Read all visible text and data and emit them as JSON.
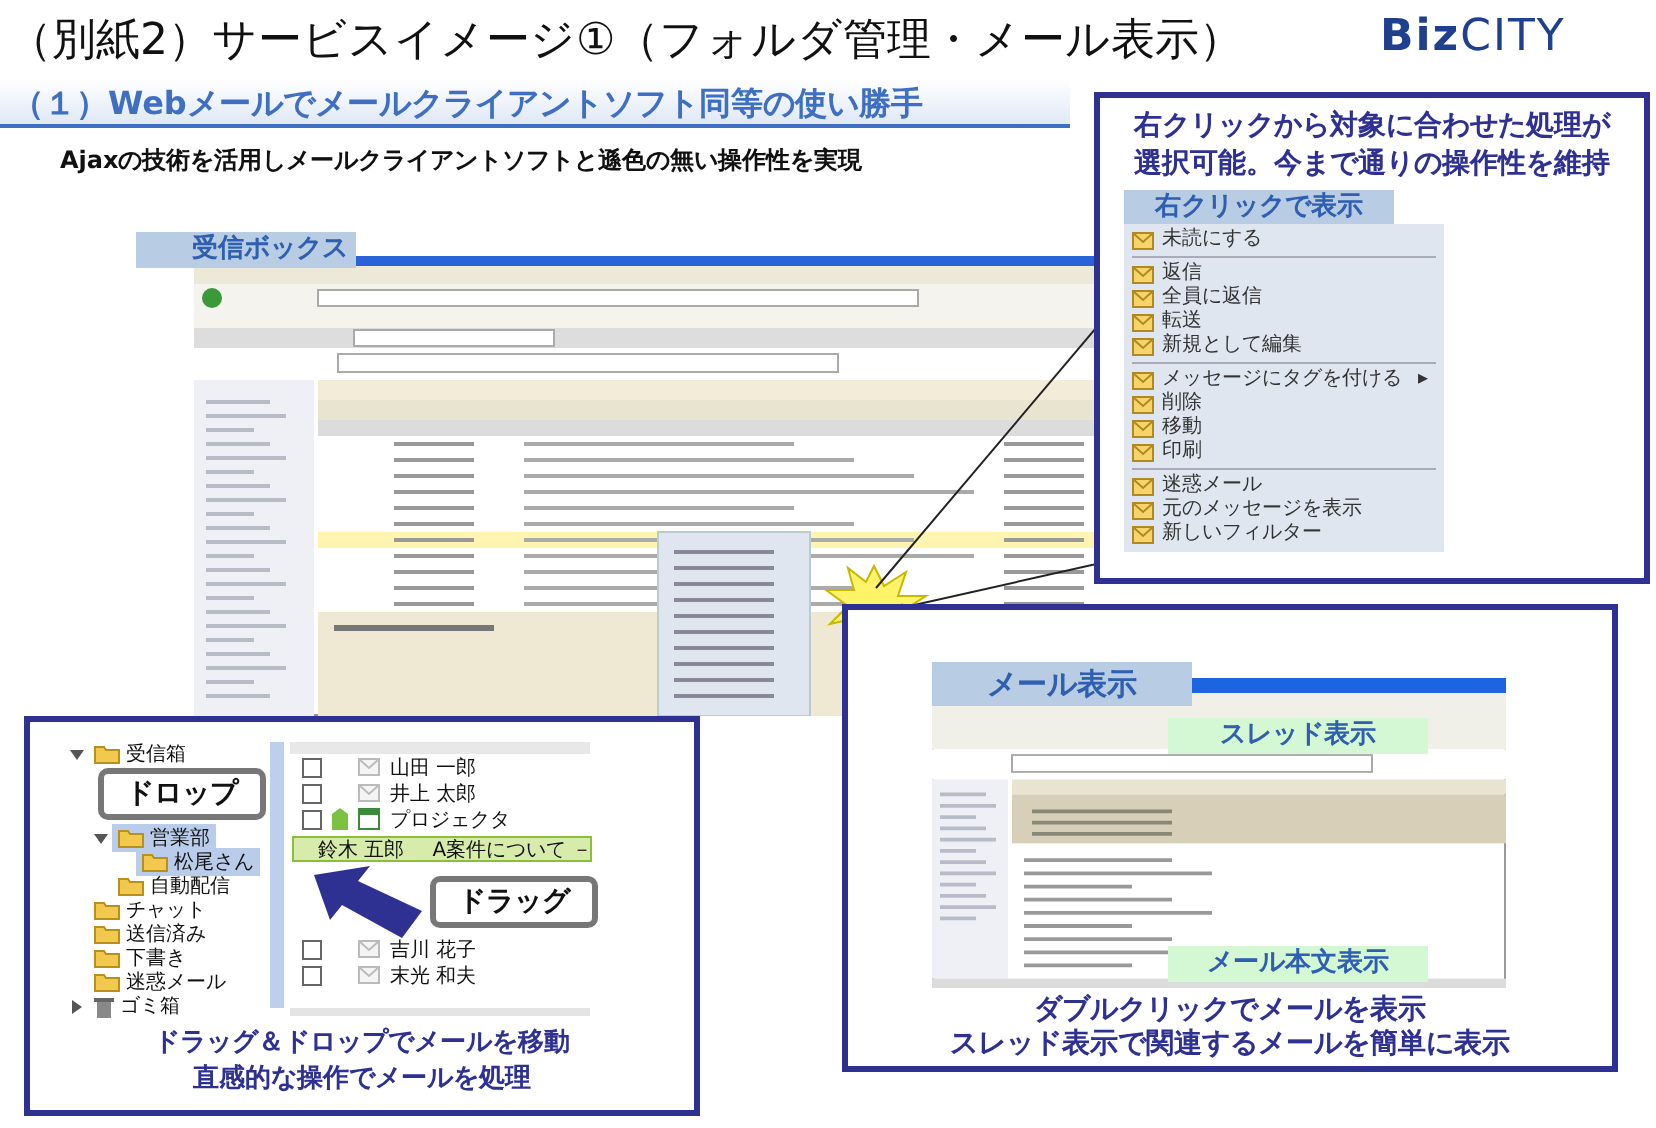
{
  "title": "（別紙2）サービスイメージ①（フォルダ管理・メール表示）",
  "logo": "**Biz**CITY",
  "section_heading": "（１）Webメールでメールクライアントソフト同等の使い勝手",
  "lead": "Ajaxの技術を活用しメールクライアントソフトと遜色の無い操作性を実現",
  "inbox_screenshot": {
    "label": "受信ボックス"
  },
  "right_click_callout": {
    "text": [
      "右クリックから対象に合わせた処理が",
      "選択可能。今まで通りの操作性を維持"
    ],
    "label": "右クリックで表示",
    "menu": [
      {
        "kind": "item",
        "label": "未読にする"
      },
      {
        "kind": "separator"
      },
      {
        "kind": "item",
        "label": "返信"
      },
      {
        "kind": "item",
        "label": "全員に返信"
      },
      {
        "kind": "item",
        "label": "転送"
      },
      {
        "kind": "item",
        "label": "新規として編集"
      },
      {
        "kind": "separator"
      },
      {
        "kind": "item",
        "label": "メッセージにタグを付ける",
        "submenu": "▸"
      },
      {
        "kind": "item",
        "label": "削除"
      },
      {
        "kind": "item",
        "label": "移動"
      },
      {
        "kind": "item",
        "label": "印刷"
      },
      {
        "kind": "separator"
      },
      {
        "kind": "item",
        "label": "迷惑メール"
      },
      {
        "kind": "item",
        "label": "元のメッセージを表示"
      },
      {
        "kind": "item",
        "label": "新しいフィルター"
      }
    ]
  },
  "drag_drop_panel": {
    "drop_label": "ドロップ",
    "drag_label": "ドラッグ",
    "folders": [
      {
        "kind": "folder",
        "label": "受信箱",
        "expanded": true,
        "selected": false,
        "children": [
          {
            "kind": "folder",
            "label": "営業部",
            "expanded": true,
            "selected": true,
            "children": [
              {
                "kind": "folder",
                "label": "松尾さん",
                "selected": true
              }
            ]
          },
          {
            "kind": "folder",
            "label": "自動配信",
            "selected": false
          }
        ]
      },
      {
        "kind": "folder",
        "label": "チャット",
        "selected": false
      },
      {
        "kind": "folder",
        "label": "送信済み",
        "selected": false
      },
      {
        "kind": "folder",
        "label": "下書き",
        "selected": false
      },
      {
        "kind": "folder",
        "label": "迷惑メール",
        "selected": false
      },
      {
        "kind": "trash",
        "label": "ゴミ箱",
        "expanded": false,
        "selected": false
      }
    ],
    "mails": [
      {
        "kind": "mail",
        "checked": false,
        "name": "山田 一郎"
      },
      {
        "kind": "mail",
        "checked": false,
        "name": "井上 太郎"
      },
      {
        "kind": "calendar",
        "checked": false,
        "color": "#7cc242",
        "name": "プロジェクタ"
      },
      {
        "kind": "mail",
        "checked": false,
        "name": "吉川 花子"
      },
      {
        "kind": "mail",
        "checked": false,
        "name": "末光 和夫"
      }
    ],
    "dragged_mail": {
      "name": "鈴木 五郎",
      "subject": "A案件について －"
    },
    "caption": [
      "ドラッグ＆ドロップでメールを移動",
      "直感的な操作でメールを処理"
    ]
  },
  "mail_view_panel": {
    "label": "メール表示",
    "thread_label": "スレッド表示",
    "body_label": "メール本文表示",
    "caption": [
      "ダブルクリックでメールを表示",
      "スレッド表示で関連するメールを簡単に表示"
    ]
  }
}
